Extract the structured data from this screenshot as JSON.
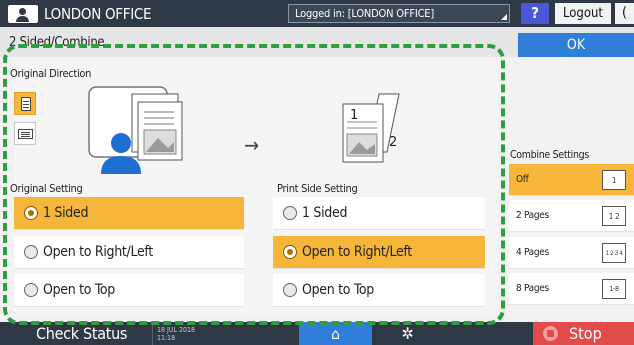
{
  "header": {
    "office_label": "LONDON OFFICE",
    "logged_in_text": "Logged in: [LONDON OFFICE]",
    "help_label": "?",
    "logout_label": "Logout",
    "night_label": "("
  },
  "titlebar": {
    "title": "2 Sided/Combine",
    "ok_label": "OK"
  },
  "original_direction": {
    "label": "Original Direction",
    "options": [
      {
        "icon": "portrait-document-icon",
        "selected": true
      },
      {
        "icon": "landscape-document-icon",
        "selected": false
      }
    ]
  },
  "arrow_glyph": "→",
  "preview": {
    "page_front": "1",
    "page_back": "2"
  },
  "original_setting": {
    "label": "Original Setting",
    "options": [
      {
        "label": "1 Sided",
        "selected": true
      },
      {
        "label": "Open to Right/Left",
        "selected": false
      },
      {
        "label": "Open to Top",
        "selected": false
      }
    ]
  },
  "print_side_setting": {
    "label": "Print Side Setting",
    "options": [
      {
        "label": "1 Sided",
        "selected": false
      },
      {
        "label": "Open to Right/Left",
        "selected": true
      },
      {
        "label": "Open to Top",
        "selected": false
      }
    ]
  },
  "combine_settings": {
    "label": "Combine Settings",
    "options": [
      {
        "label": "Off",
        "icon_text": "1",
        "selected": true
      },
      {
        "label": "2 Pages",
        "icon_text": "1 2",
        "selected": false
      },
      {
        "label": "4 Pages",
        "icon_text": "1 2 3 4",
        "selected": false
      },
      {
        "label": "8 Pages",
        "icon_text": "1-8",
        "selected": false
      }
    ]
  },
  "footer": {
    "check_status_label": "Check Status",
    "date": "18 JUL 2018",
    "time": "11:18",
    "home_icon": "⌂",
    "gear_icon": "✲",
    "stop_label": "Stop"
  },
  "colors": {
    "accent": "#f5b63a",
    "dashed_outline": "#2f9e3f",
    "primary_blue": "#2f7fd9",
    "bar_dark": "#2f3845",
    "stop_red": "#e24b4b"
  }
}
